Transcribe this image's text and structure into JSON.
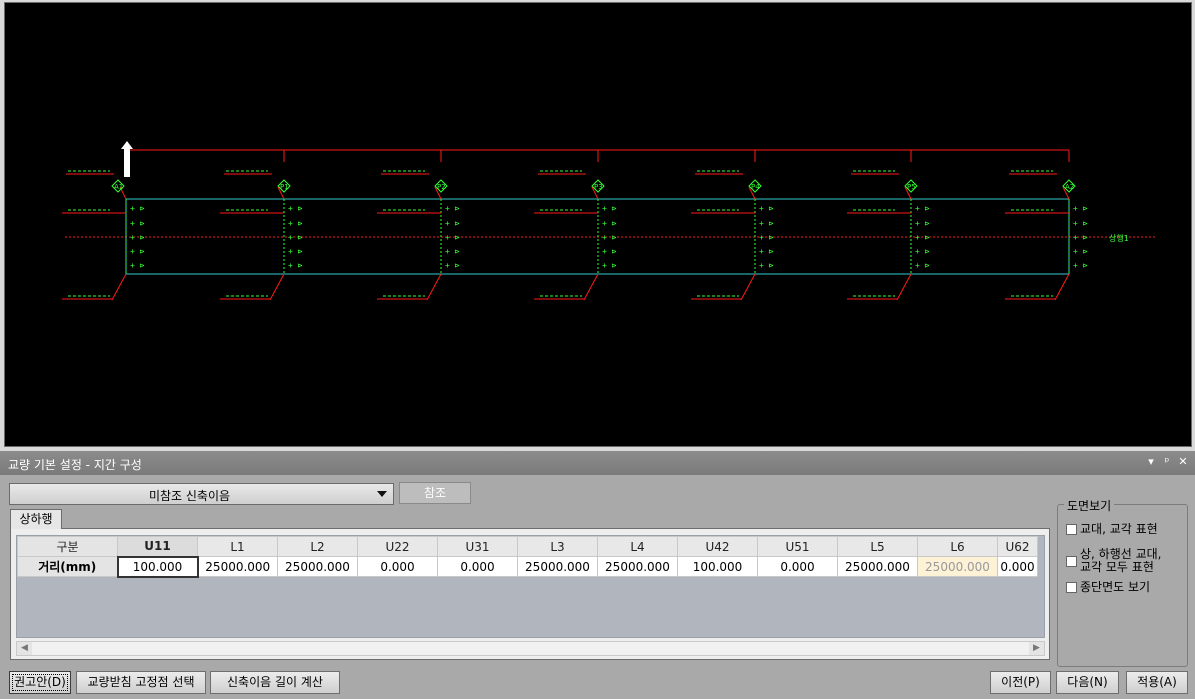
{
  "panel": {
    "title": "교량 기본 설정 - 지간 구성",
    "controls": {
      "dropdown": "▾",
      "pin": "ᵖ",
      "close": "✕"
    }
  },
  "reference": {
    "selected": "미참조 신축이음",
    "button_label": "참조"
  },
  "tab_label": "상하행",
  "grid": {
    "header_label": "구분",
    "row_label": "거리(mm)",
    "columns": [
      "U11",
      "L1",
      "L2",
      "U22",
      "U31",
      "L3",
      "L4",
      "U42",
      "U51",
      "L5",
      "L6",
      "U62"
    ],
    "values": [
      "100.000",
      "25000.000",
      "25000.000",
      "0.000",
      "0.000",
      "25000.000",
      "25000.000",
      "100.000",
      "0.000",
      "25000.000",
      "25000.000",
      "0.000"
    ]
  },
  "view_options": {
    "legend": "도면보기",
    "items": [
      {
        "line1": "교대, 교각 표현",
        "line2": ""
      },
      {
        "line1": "상, 하행선 교대,",
        "line2": "교각 모두 표현"
      },
      {
        "line1": "종단면도 보기",
        "line2": ""
      }
    ]
  },
  "buttons": {
    "recommend": "권고안(D)",
    "bearing_fixed": "교량받침 고정점 선택",
    "joint_length": "신축이음 길이 계산",
    "prev": "이전(P)",
    "next": "다음(N)",
    "apply": "적용(A)"
  },
  "drawing": {
    "pier_labels": [
      "A1",
      "P1",
      "P2",
      "P3",
      "P4",
      "P5",
      "A2"
    ],
    "side_label": "상행1",
    "colors": {
      "span_line": "#ff1a1a",
      "deck": "#33cccc",
      "annotation": "#33ff33",
      "arrow": "#ffffff"
    }
  },
  "colors": {
    "panel_bg": "#a9a9a9",
    "title_bar": "#808080",
    "grid_bg": "#b1b5be",
    "highlight": "#fdf1d6"
  }
}
